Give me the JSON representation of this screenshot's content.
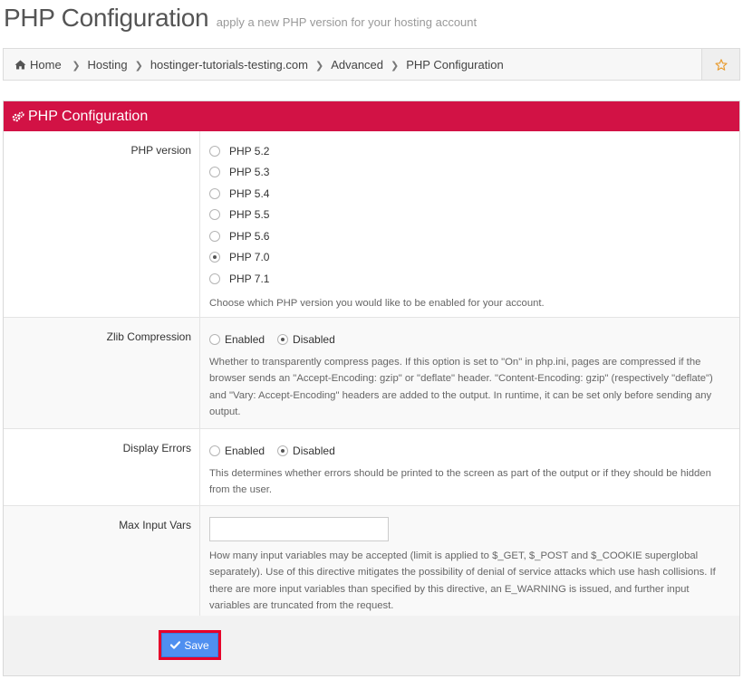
{
  "header": {
    "title": "PHP Configuration",
    "subtitle": "apply a new PHP version for your hosting account"
  },
  "breadcrumb": {
    "items": [
      "Home",
      "Hosting",
      "hostinger-tutorials-testing.com",
      "Advanced",
      "PHP Configuration"
    ],
    "home_icon": "home-icon",
    "favorite_icon": "star-icon"
  },
  "panel": {
    "title": "PHP Configuration",
    "icon": "gears-icon",
    "accent_color": "#d21245"
  },
  "php_version": {
    "label": "PHP version",
    "options": [
      "PHP 5.2",
      "PHP 5.3",
      "PHP 5.4",
      "PHP 5.5",
      "PHP 5.6",
      "PHP 7.0",
      "PHP 7.1"
    ],
    "selected": "PHP 7.0",
    "help": "Choose which PHP version you would like to be enabled for your account."
  },
  "zlib": {
    "label": "Zlib Compression",
    "options": [
      "Enabled",
      "Disabled"
    ],
    "selected": "Disabled",
    "help": "Whether to transparently compress pages. If this option is set to \"On\" in php.ini, pages are compressed if the browser sends an \"Accept-Encoding: gzip\" or \"deflate\" header. \"Content-Encoding: gzip\" (respectively \"deflate\") and \"Vary: Accept-Encoding\" headers are added to the output. In runtime, it can be set only before sending any output."
  },
  "display_errors": {
    "label": "Display Errors",
    "options": [
      "Enabled",
      "Disabled"
    ],
    "selected": "Disabled",
    "help": "This determines whether errors should be printed to the screen as part of the output or if they should be hidden from the user."
  },
  "max_input_vars": {
    "label": "Max Input Vars",
    "value": "",
    "help": "How many input variables may be accepted (limit is applied to $_GET, $_POST and $_COOKIE superglobal separately). Use of this directive mitigates the possibility of denial of service attacks which use hash collisions. If there are more input variables than specified by this directive, an E_WARNING is issued, and further input variables are truncated from the request."
  },
  "save": {
    "label": "Save",
    "icon": "check-icon",
    "color": "#4f8ff0",
    "highlight_color": "#e6002a"
  }
}
